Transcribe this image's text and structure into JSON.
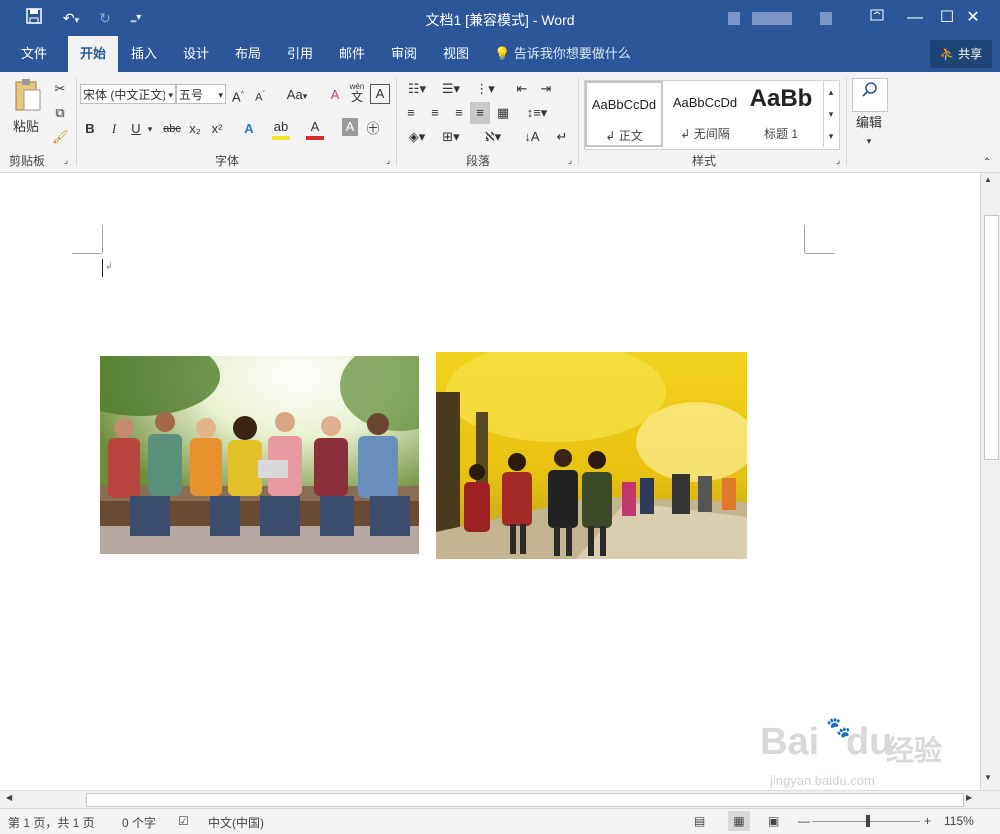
{
  "window": {
    "title": "文档1 [兼容模式] - Word"
  },
  "tabs": [
    "文件",
    "开始",
    "插入",
    "设计",
    "布局",
    "引用",
    "邮件",
    "审阅",
    "视图"
  ],
  "tell_me": "告诉我你想要做什么",
  "share_label": "共享",
  "ribbon": {
    "clipboard": {
      "paste": "粘贴",
      "label": "剪贴板"
    },
    "font": {
      "font_name": "宋体 (中文正文)",
      "font_size": "五号",
      "label": "字体",
      "change_case": "Aa",
      "bold": "B",
      "italic": "I",
      "underline": "U",
      "strike": "abc",
      "subscript": "x₂",
      "superscript": "x²",
      "phonetic": "wén",
      "phonetic2": "文"
    },
    "paragraph": {
      "label": "段落"
    },
    "styles": {
      "label": "样式",
      "items": [
        {
          "sample": "AaBbCcDd",
          "name": "正文"
        },
        {
          "sample": "AaBbCcDd",
          "name": "无间隔"
        },
        {
          "sample": "AaBb",
          "name": "标题 1"
        }
      ]
    },
    "editing": {
      "label": "编辑"
    }
  },
  "status": {
    "page": "第 1 页，共 1 页",
    "words": "0 个字",
    "lang": "中文(中国)",
    "zoom": "115%"
  },
  "watermark": {
    "text1": "Bai",
    "text2": "du",
    "text3": "经验",
    "url": "jingyan.baidu.com"
  },
  "icons": [
    "save-icon",
    "undo-icon",
    "redo-icon",
    "customize-icon",
    "lightbulb-icon",
    "person-icon",
    "search-icon"
  ]
}
